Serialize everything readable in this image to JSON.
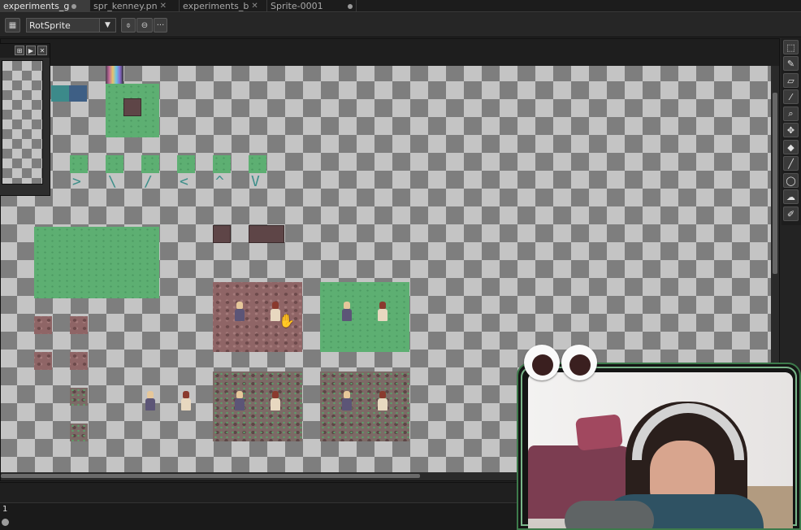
{
  "tabs": [
    {
      "label": "experiments_g",
      "state": "modified",
      "active": true
    },
    {
      "label": "spr_kenney.pn",
      "state": "close",
      "active": false
    },
    {
      "label": "experiments_b",
      "state": "close",
      "active": false
    },
    {
      "label": "Sprite-0001",
      "state": "modified",
      "active": false
    }
  ],
  "toolbar": {
    "mode_icon": "grid-icon",
    "transform_select": {
      "value": "RotSprite"
    },
    "pivot_icon": "pivot-icon",
    "flip_icon": "flip-icon",
    "more_label": "···"
  },
  "canvas": {
    "background": "transparency-checkerboard",
    "direction_glyphs": [
      ">",
      "\\",
      "/",
      "<",
      "^",
      "V"
    ]
  },
  "preview_panel": {
    "icons": [
      "fit-icon",
      "play-icon",
      "close-icon"
    ]
  },
  "tools": [
    "rectangle-marquee-icon",
    "pencil-icon",
    "eraser-icon",
    "eyedropper-icon",
    "zoom-icon",
    "move-icon",
    "paint-bucket-icon",
    "line-icon",
    "ellipse-icon",
    "contour-icon",
    "blur-brush-icon"
  ],
  "timeline": {
    "frame_number": "1"
  },
  "colors": {
    "grass": "#5daf72",
    "rock": "#8f6566",
    "accent_border": "#3d7a4b"
  }
}
